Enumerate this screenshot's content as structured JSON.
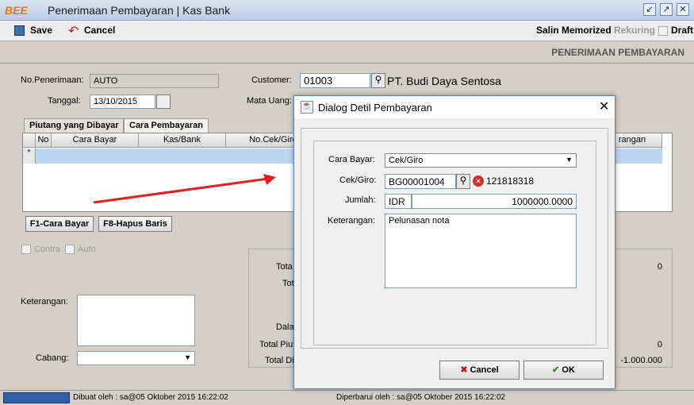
{
  "window": {
    "title": "Penerimaan Pembayaran | Kas Bank",
    "logo": "BEE"
  },
  "toolbar": {
    "save": "Save",
    "cancel": "Cancel",
    "salin": "Salin Memorized",
    "rekuring": "Rekuring",
    "draft": "Draft"
  },
  "header": {
    "title": "PENERIMAAN PEMBAYARAN"
  },
  "form": {
    "no_penerimaan_label": "No.Penerimaan:",
    "no_penerimaan": "AUTO",
    "tanggal_label": "Tanggal:",
    "tanggal": "13/10/2015",
    "customer_label": "Customer:",
    "customer_code": "01003",
    "customer_name": "PT. Budi Daya Sentosa",
    "mata_uang_label": "Mata Uang:"
  },
  "tabs": [
    "Piutang yang Dibayar",
    "Cara Pembayaran"
  ],
  "grid": {
    "headers": [
      "No",
      "Cara Bayar",
      "Kas/Bank",
      "No.Cek/Giro",
      "rangan"
    ],
    "row_marker": "*"
  },
  "buttons": {
    "f1": "F1-Cara Bayar",
    "f8": "F8-Hapus Baris"
  },
  "options": {
    "contra": "Contra",
    "auto": "Auto"
  },
  "lower": {
    "keterangan_label": "Keterangan:",
    "cabang_label": "Cabang:",
    "totals_labels": [
      "Tota",
      "Tot",
      "Dala",
      "Total Piut",
      "Total Di"
    ],
    "totals_values": [
      "0",
      "0",
      "-1.000.000"
    ]
  },
  "status": {
    "dibuat": "Dibuat oleh : sa@05 Oktober 2015  16:22:02",
    "diperbarui": "Diperbarui oleh : sa@05 Oktober 2015  16:22:02"
  },
  "dialog": {
    "title": "Dialog Detil Pembayaran",
    "cara_bayar_label": "Cara Bayar:",
    "cara_bayar": "Cek/Giro",
    "cek_giro_label": "Cek/Giro:",
    "cek_giro": "BG00001004",
    "cek_giro_no": "121818318",
    "jumlah_label": "Jumlah:",
    "currency": "IDR",
    "jumlah": "1000000.0000",
    "keterangan_label": "Keterangan:",
    "keterangan": "Pelunasan nota",
    "cancel": "Cancel",
    "ok": "OK"
  }
}
